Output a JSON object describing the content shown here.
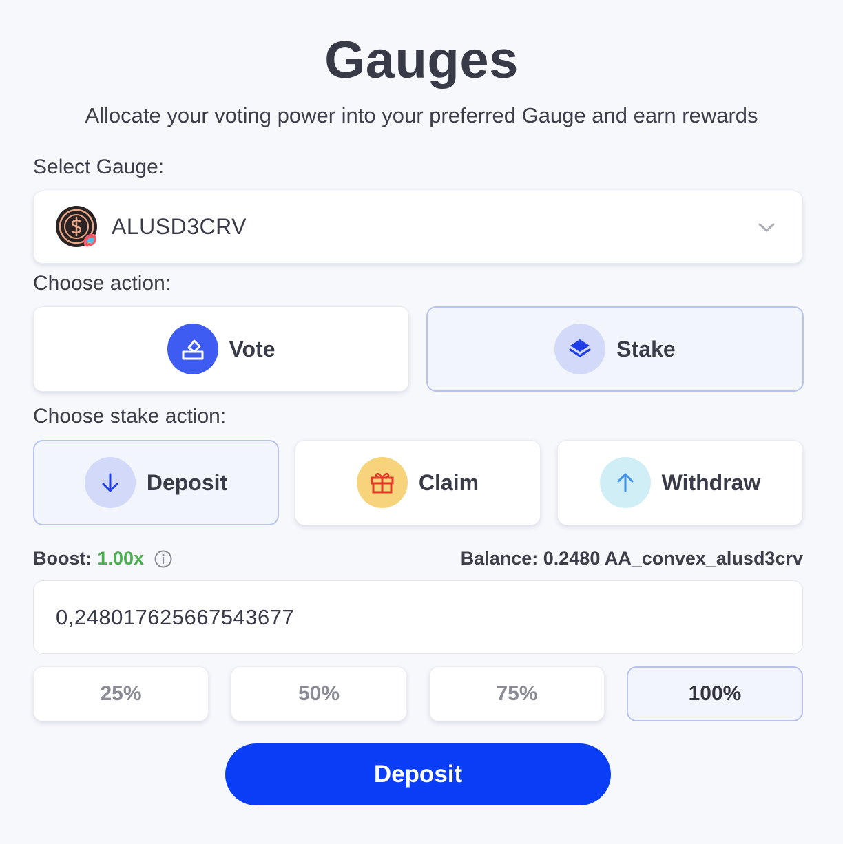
{
  "header": {
    "title": "Gauges",
    "subtitle": "Allocate your voting power into your preferred Gauge and earn rewards"
  },
  "gauge_select": {
    "label": "Select Gauge:",
    "value": "ALUSD3CRV",
    "icon": "alusd-token-icon"
  },
  "action": {
    "label": "Choose action:",
    "options": [
      {
        "label": "Vote",
        "icon": "vote-icon",
        "selected": false
      },
      {
        "label": "Stake",
        "icon": "stack-layers-icon",
        "selected": true
      }
    ]
  },
  "stake_action": {
    "label": "Choose stake action:",
    "options": [
      {
        "label": "Deposit",
        "icon": "arrow-down-icon",
        "selected": true
      },
      {
        "label": "Claim",
        "icon": "gift-icon",
        "selected": false
      },
      {
        "label": "Withdraw",
        "icon": "arrow-up-icon",
        "selected": false
      }
    ]
  },
  "boost": {
    "label": "Boost:",
    "value": "1.00x"
  },
  "balance": {
    "text": "Balance: 0.2480 AA_convex_alusd3crv"
  },
  "amount": {
    "value": "0,248017625667543677"
  },
  "percent_buttons": [
    {
      "label": "25%",
      "selected": false
    },
    {
      "label": "50%",
      "selected": false
    },
    {
      "label": "75%",
      "selected": false
    },
    {
      "label": "100%",
      "selected": true
    }
  ],
  "submit": {
    "label": "Deposit"
  },
  "colors": {
    "background": "#f6f8fc",
    "primary": "#0a3ef6",
    "vote_icon_bg": "#3f5cf2",
    "selected_icon_bg": "#d3d9f8",
    "claim_icon_bg": "#f7d37b",
    "withdraw_icon_bg": "#d0eef6",
    "boost_green": "#4caf50"
  }
}
